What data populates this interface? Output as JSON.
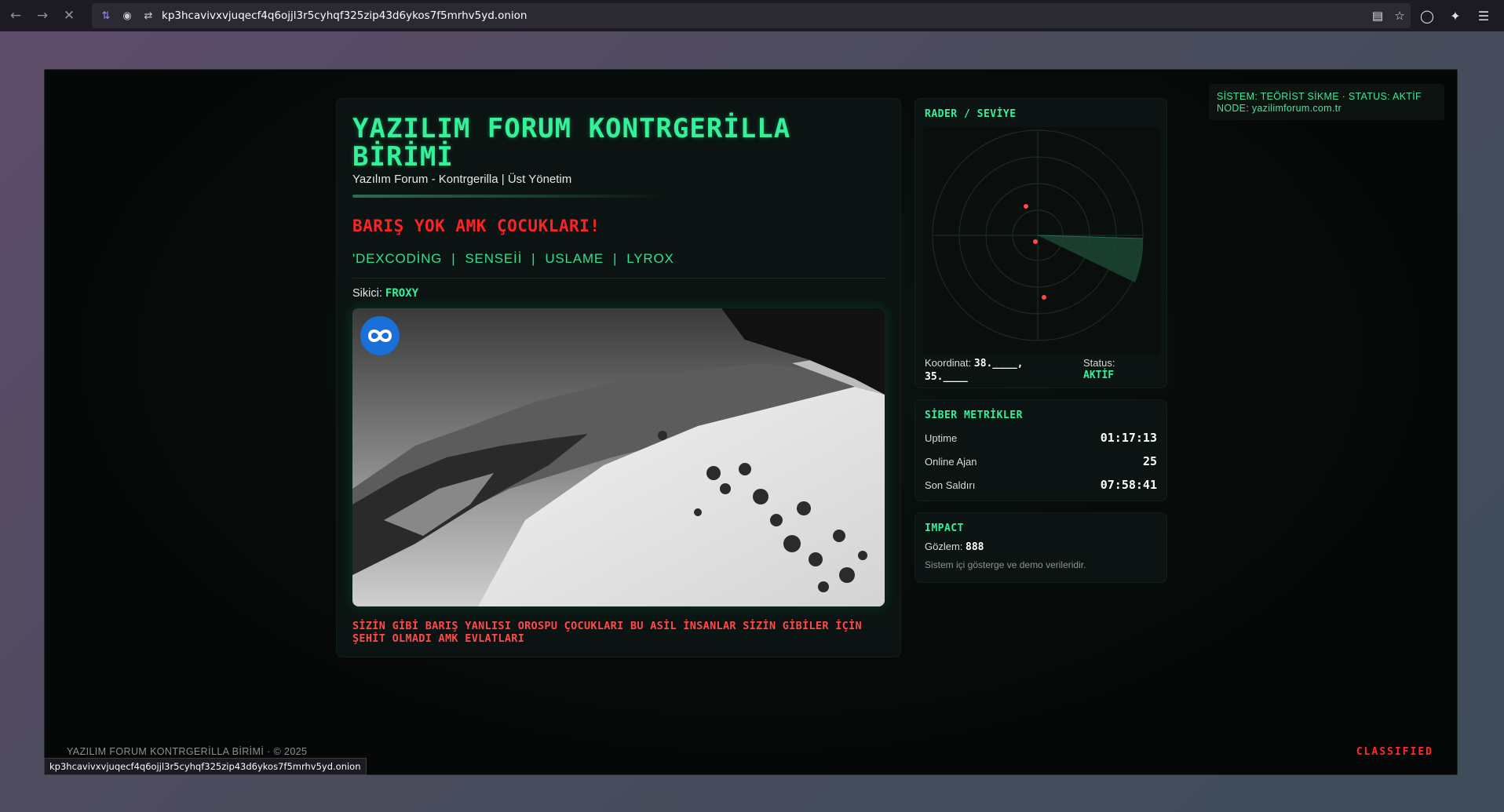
{
  "browser": {
    "url": "kp3hcavivxvjuqecf4q6ojjl3r5cyhqf325zip43d6ykos7f5mrhv5yd.onion",
    "status_link": "kp3hcavivxvjuqecf4q6ojjl3r5cyhqf325zip43d6ykos7f5mrhv5yd.onion"
  },
  "system_box": {
    "line1": "SİSTEM: TEÖRİST SİKME · STATUS: AKTİF",
    "line2": "NODE: yazilimforum.com.tr"
  },
  "main": {
    "title": "YAZILIM FORUM KONTRGERİLLA BİRİMİ",
    "subtitle": "Yazılım Forum - Kontrgerilla | Üst Yönetim",
    "warning": "BARIŞ YOK AMK ÇOCUKLARI!",
    "names": [
      "'DEXCODİNG",
      "SENSEİİ",
      "USLAME",
      "LYROX"
    ],
    "separator": "|",
    "sikici_label": "Sikici:",
    "sikici_value": "FROXY",
    "caption": "SİZİN GİBİ BARIŞ YANLISI OROSPU ÇOCUKLARI BU ASİL İNSANLAR SİZİN GİBİLER İÇİN ŞEHİT OLMADI AMK EVLATLARI"
  },
  "radar": {
    "title": "RADER / SEVİYE",
    "coord_label": "Koordinat:",
    "coord_value": "38.____, 35.____",
    "status_label": "Status:",
    "status_value": "AKTİF"
  },
  "metrics": {
    "title": "SİBER METRİKLER",
    "rows": [
      {
        "label": "Uptime",
        "value": "01:17:13"
      },
      {
        "label": "Online Ajan",
        "value": "25"
      },
      {
        "label": "Son Saldırı",
        "value": "07:58:41"
      }
    ]
  },
  "impact": {
    "title": "IMPACT",
    "gozlem_label": "Gözlem:",
    "gozlem_value": "888",
    "note": "Sistem içi gösterge ve demo verileridir."
  },
  "footer": {
    "left": "YAZILIM FORUM KONTRGERİLLA BİRİMİ · © 2025",
    "right": "CLASSIFIED"
  },
  "colors": {
    "accent": "#33f29a",
    "danger": "#ff2222",
    "panel": "#0b1412"
  }
}
